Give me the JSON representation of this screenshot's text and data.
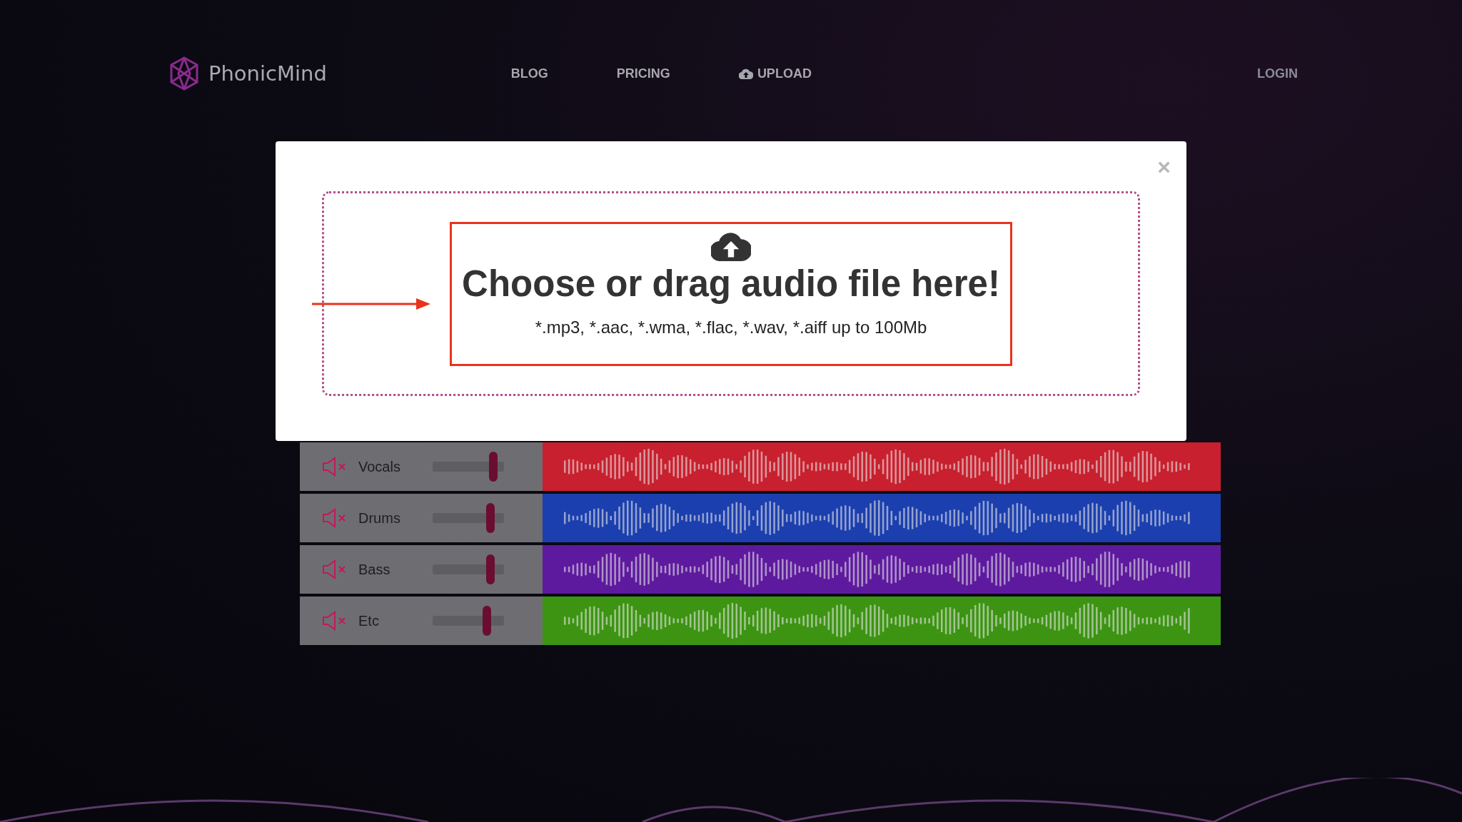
{
  "header": {
    "logo": "PhonicMind",
    "nav": [
      {
        "label": "BLOG",
        "kind": "text"
      },
      {
        "label": "PRICING",
        "kind": "text"
      },
      {
        "label": "UPLOAD",
        "kind": "upload"
      }
    ],
    "login": "LOGIN"
  },
  "modal": {
    "close": "×",
    "title": "Choose or drag audio file here!",
    "formats": "*.mp3, *.aac, *.wma, *.flac, *.wav, *.aiff up to 100Mb"
  },
  "tracks": [
    {
      "name": "Vocals",
      "color": "#c8202e",
      "level": 0.9
    },
    {
      "name": "Drums",
      "color": "#1b3fae",
      "level": 0.85
    },
    {
      "name": "Bass",
      "color": "#5e1a9e",
      "level": 0.85
    },
    {
      "name": "Etc",
      "color": "#3c9412",
      "level": 0.8
    }
  ]
}
